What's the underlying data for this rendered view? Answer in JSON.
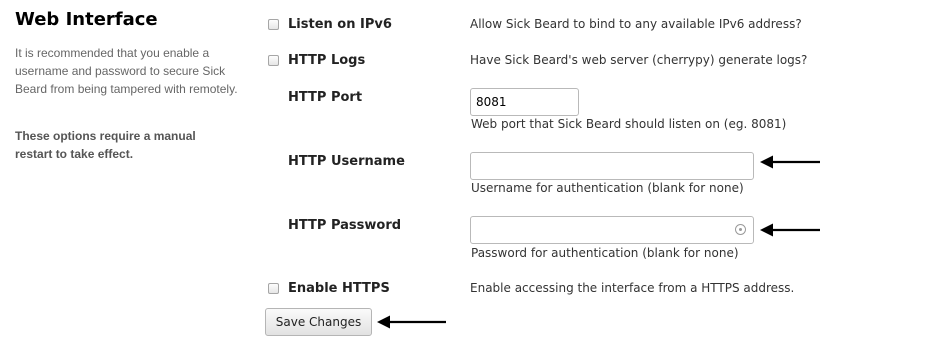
{
  "section": {
    "title": "Web Interface",
    "description": "It is recommended that you enable a username and password to secure Sick Beard from being tampered with remotely.",
    "note": "These options require a manual restart to take effect."
  },
  "options": {
    "ipv6": {
      "label": "Listen on IPv6",
      "help": "Allow Sick Beard to bind to any available IPv6 address?",
      "checked": false
    },
    "http_logs": {
      "label": "HTTP Logs",
      "help": "Have Sick Beard's web server (cherrypy) generate logs?",
      "checked": false
    },
    "http_port": {
      "label": "HTTP Port",
      "value": "8081",
      "help": "Web port that Sick Beard should listen on (eg. 8081)"
    },
    "http_username": {
      "label": "HTTP Username",
      "value": "",
      "help": "Username for authentication (blank for none)"
    },
    "http_password": {
      "label": "HTTP Password",
      "value": "",
      "help": "Password for authentication (blank for none)"
    },
    "https": {
      "label": "Enable HTTPS",
      "help": "Enable accessing the interface from a HTTPS address.",
      "checked": false
    }
  },
  "save_button": {
    "label": "Save Changes"
  },
  "annotations": {
    "arrow_icon": "arrow-left-icon",
    "color": "#000000"
  }
}
